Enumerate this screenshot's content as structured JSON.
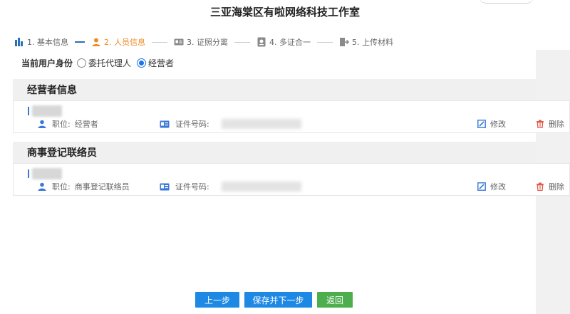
{
  "header": {
    "title": "三亚海棠区有啦网络科技工作室"
  },
  "steps": [
    {
      "label": "1. 基本信息",
      "state": "done",
      "icon": "building-icon"
    },
    {
      "label": "2. 人员信息",
      "state": "active",
      "icon": "person-icon"
    },
    {
      "label": "3. 证照分离",
      "state": "pending",
      "icon": "id-card-icon"
    },
    {
      "label": "4. 多证合一",
      "state": "pending",
      "icon": "certificate-icon"
    },
    {
      "label": "5. 上传材料",
      "state": "pending",
      "icon": "upload-icon"
    }
  ],
  "identity": {
    "label": "当前用户身份",
    "options": [
      {
        "label": "委托代理人",
        "checked": false
      },
      {
        "label": "经营者",
        "checked": true
      }
    ]
  },
  "sections": [
    {
      "title": "经营者信息",
      "card": {
        "position_label": "职位:",
        "position_value": "经营者",
        "id_label": "证件号码:",
        "edit_label": "修改",
        "delete_label": "删除"
      }
    },
    {
      "title": "商事登记联络员",
      "card": {
        "position_label": "职位:",
        "position_value": "商事登记联络员",
        "id_label": "证件号码:",
        "edit_label": "修改",
        "delete_label": "删除"
      }
    }
  ],
  "buttons": {
    "prev": "上一步",
    "save_next": "保存并下一步",
    "back": "返回"
  },
  "colors": {
    "primary": "#1e88e5",
    "success": "#4cae4c",
    "active_step": "#f08a24",
    "delete_icon": "#e05a4e",
    "section_bg": "#f0f0f0"
  }
}
